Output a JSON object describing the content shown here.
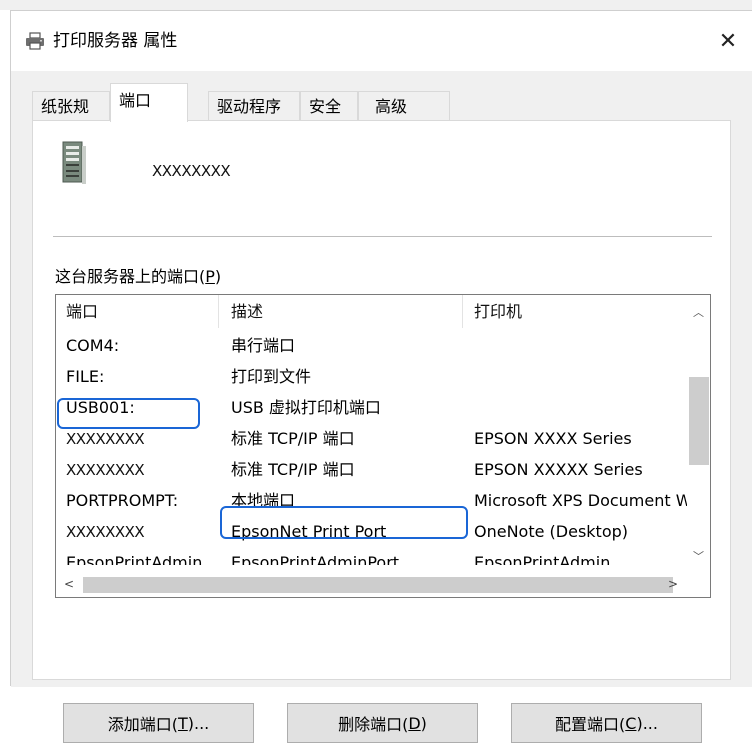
{
  "window": {
    "title": "打印服务器 属性",
    "close_glyph": "✕"
  },
  "tabs": [
    {
      "label": "纸张规格",
      "active": false
    },
    {
      "label": "端口",
      "active": true
    },
    {
      "label": "驱动程序",
      "active": false
    },
    {
      "label": "安全",
      "active": false
    },
    {
      "label": "高级",
      "active": false
    }
  ],
  "server": {
    "name": "XXXXXXXX",
    "icon": "server-tower-icon"
  },
  "ports_label": {
    "prefix": "这台服务器上的端口(",
    "mnemonic": "P",
    "suffix": ")"
  },
  "list": {
    "columns": [
      "端口",
      "描述",
      "打印机"
    ],
    "rows": [
      {
        "port": "COM4:",
        "desc": "串行端口",
        "printer": ""
      },
      {
        "port": "FILE:",
        "desc": "打印到文件",
        "printer": ""
      },
      {
        "port": "USB001:",
        "desc": "USB 虚拟打印机端口",
        "printer": ""
      },
      {
        "port": "XXXXXXXX",
        "desc": "标准 TCP/IP 端口",
        "printer": "EPSON  XXXX Series"
      },
      {
        "port": "XXXXXXXX",
        "desc": "标准 TCP/IP 端口",
        "printer": "EPSON  XXXXX Series"
      },
      {
        "port": "PORTPROMPT:",
        "desc": "本地端口",
        "printer": "Microsoft XPS Document Writer"
      },
      {
        "port": "XXXXXXXX",
        "desc": "EpsonNet Print Port",
        "printer": "OneNote (Desktop)"
      },
      {
        "port": "EpsonPrintAdmin",
        "desc": "EpsonPrintAdminPort",
        "printer": "EpsonPrintAdmin"
      }
    ]
  },
  "buttons": {
    "add": {
      "prefix": "添加端口(",
      "mnemonic": "T",
      "suffix": ")..."
    },
    "delete": {
      "prefix": "删除端口(",
      "mnemonic": "D",
      "suffix": ")"
    },
    "configure": {
      "prefix": "配置端口(",
      "mnemonic": "C",
      "suffix": ")..."
    }
  },
  "colors": {
    "highlight": "#1a66d6",
    "panel_bg": "#f0f0f0"
  }
}
